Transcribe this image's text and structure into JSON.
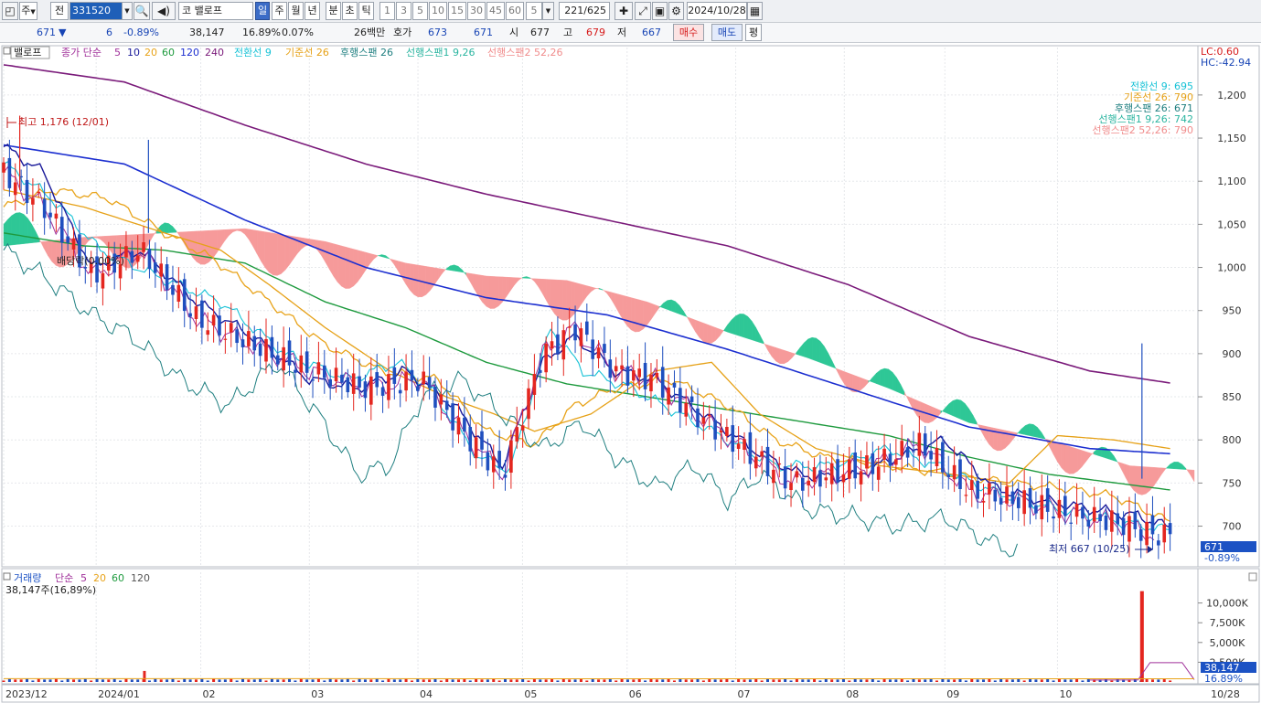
{
  "toolbar": {
    "market": "주",
    "prev": "전",
    "code": "331520",
    "name": "밸로프",
    "type_prefix": "코",
    "periods": [
      "일",
      "주",
      "월",
      "년",
      "분",
      "초",
      "틱"
    ],
    "active_period": "일",
    "minute_steps": [
      "1",
      "3",
      "5",
      "10",
      "15",
      "30",
      "45",
      "60"
    ],
    "step_value": "5",
    "count": "221",
    "count_total": "/625",
    "date": "2024/10/28"
  },
  "quote": {
    "price": "671",
    "change_arrow": "▼",
    "change": "6",
    "change_pct": "-0.89%",
    "volume": "38,147",
    "turnover_pct": "16.89%",
    "ratio": "0.07%",
    "amount": "26백만",
    "bid_label": "호가",
    "bid1": "673",
    "bid2": "671",
    "open_label": "시",
    "open": "677",
    "high_label": "고",
    "high": "679",
    "low_label": "저",
    "low": "667",
    "buy_label": "매수",
    "sell_label": "매도",
    "avg_label": "평"
  },
  "legend": {
    "top_box": "밸로프",
    "ma_title": "종가 단순",
    "ma_periods": [
      "5",
      "10",
      "20",
      "60",
      "120",
      "240"
    ],
    "ichimoku": [
      "전환선 9",
      "기준선 26",
      "후행스팬 26",
      "선행스팬1 9,26",
      "선행스팬2 52,26"
    ],
    "lc": "LC:0.60",
    "hc": "HC:-42.94"
  },
  "ichi_labels": [
    "전환선 9: 695",
    "기준선 26: 790",
    "후행스팬 26: 671",
    "선행스팬1 9,26: 742",
    "선행스팬2 52,26: 790"
  ],
  "annotations": {
    "high": "최고 1,176 (12/01)",
    "low": "최저 667 (10/25)",
    "ex_right": "배당락(0.00%)",
    "price_tag": "671",
    "price_tag_pct": "-0.89%"
  },
  "volume_legend": {
    "title": "거래량",
    "ma_title": "단순",
    "ma_periods": [
      "5",
      "20",
      "60",
      "120"
    ],
    "value": "38,147주(16,89%)",
    "tag": "38,147",
    "tag_pct": "16.89%"
  },
  "colors": {
    "up": "#e4261f",
    "down": "#1f4fbf",
    "ma5": "#a0309a",
    "ma10": "#1a1a9a",
    "ma20": "#e8a319",
    "ma60": "#1e9a3e",
    "ma120": "#1c2fd0",
    "ma240": "#7a1a7a",
    "tenkan": "#17c2d6",
    "kijun": "#e6a117",
    "chikou": "#1f7f80",
    "cloud_bull": "#2ec796",
    "cloud_bear": "#f69a9a",
    "span_a": "#2bb5a0",
    "span_b": "#f08c8c"
  },
  "chart_data": {
    "type": "candlestick",
    "y_axis": {
      "ticks": [
        "1,200",
        "1,150",
        "1,100",
        "1,050",
        "1,000",
        "950",
        "900",
        "850",
        "800",
        "750",
        "700"
      ],
      "tick_values": [
        1200,
        1150,
        1100,
        1050,
        1000,
        950,
        900,
        850,
        800,
        750,
        700
      ],
      "range": [
        655,
        1255
      ]
    },
    "volume_axis": {
      "ticks": [
        "10,000K",
        "7,500K",
        "5,000K",
        "2,500K"
      ],
      "tick_values": [
        10000,
        7500,
        5000,
        2500
      ],
      "range": [
        0,
        12500
      ]
    },
    "x_labels": [
      "2023/12",
      "2024/01",
      "02",
      "03",
      "04",
      "05",
      "06",
      "07",
      "08",
      "09",
      "10",
      "10/28"
    ],
    "x_label_days": [
      0,
      23,
      49,
      76,
      103,
      129,
      155,
      182,
      209,
      234,
      262,
      296
    ],
    "days_span": [
      0,
      296
    ],
    "series": [
      {
        "name": "전환선 9",
        "anchors": [
          [
            0,
            1120
          ],
          [
            12,
            1080
          ],
          [
            24,
            1020
          ],
          [
            38,
            990
          ],
          [
            54,
            960
          ],
          [
            70,
            900
          ],
          [
            86,
            870
          ],
          [
            98,
            890
          ],
          [
            106,
            860
          ],
          [
            118,
            780
          ],
          [
            126,
            765
          ],
          [
            136,
            930
          ],
          [
            144,
            880
          ],
          [
            156,
            860
          ],
          [
            168,
            830
          ],
          [
            180,
            800
          ],
          [
            192,
            770
          ],
          [
            206,
            770
          ],
          [
            220,
            790
          ],
          [
            232,
            770
          ],
          [
            246,
            740
          ],
          [
            262,
            720
          ],
          [
            278,
            705
          ],
          [
            286,
            698
          ],
          [
            290,
            695
          ]
        ]
      },
      {
        "name": "기준선 26",
        "anchors": [
          [
            0,
            1090
          ],
          [
            20,
            1070
          ],
          [
            40,
            1040
          ],
          [
            54,
            1020
          ],
          [
            66,
            980
          ],
          [
            80,
            930
          ],
          [
            96,
            880
          ],
          [
            110,
            850
          ],
          [
            122,
            830
          ],
          [
            132,
            810
          ],
          [
            146,
            830
          ],
          [
            162,
            880
          ],
          [
            176,
            890
          ],
          [
            188,
            830
          ],
          [
            202,
            790
          ],
          [
            218,
            770
          ],
          [
            236,
            760
          ],
          [
            250,
            750
          ],
          [
            262,
            805
          ],
          [
            276,
            800
          ],
          [
            290,
            790
          ]
        ]
      },
      {
        "name": "후행스팬 26",
        "anchors": [
          [
            0,
            1020
          ],
          [
            10,
            990
          ],
          [
            22,
            945
          ],
          [
            32,
            920
          ],
          [
            44,
            870
          ],
          [
            56,
            840
          ],
          [
            68,
            890
          ],
          [
            78,
            830
          ],
          [
            88,
            760
          ],
          [
            96,
            770
          ],
          [
            104,
            850
          ],
          [
            114,
            870
          ],
          [
            124,
            830
          ],
          [
            134,
            790
          ],
          [
            144,
            820
          ],
          [
            152,
            780
          ],
          [
            162,
            745
          ],
          [
            172,
            770
          ],
          [
            180,
            730
          ],
          [
            188,
            760
          ],
          [
            200,
            720
          ],
          [
            212,
            710
          ],
          [
            222,
            700
          ],
          [
            234,
            710
          ],
          [
            246,
            680
          ],
          [
            252,
            670
          ]
        ]
      },
      {
        "name": "이동평균 5",
        "anchors": [
          [
            0,
            1110
          ],
          [
            10,
            1070
          ],
          [
            22,
            990
          ],
          [
            34,
            1020
          ],
          [
            48,
            940
          ],
          [
            62,
            910
          ],
          [
            76,
            880
          ],
          [
            90,
            860
          ],
          [
            104,
            870
          ],
          [
            114,
            810
          ],
          [
            124,
            760
          ],
          [
            134,
            900
          ],
          [
            142,
            930
          ],
          [
            152,
            880
          ],
          [
            162,
            870
          ],
          [
            172,
            830
          ],
          [
            184,
            790
          ],
          [
            196,
            750
          ],
          [
            206,
            760
          ],
          [
            216,
            770
          ],
          [
            228,
            795
          ],
          [
            240,
            740
          ],
          [
            252,
            730
          ],
          [
            264,
            715
          ],
          [
            276,
            705
          ],
          [
            286,
            690
          ]
        ]
      },
      {
        "name": "이동평균 10",
        "anchors": [
          [
            0,
            1140
          ],
          [
            10,
            1110
          ],
          [
            22,
            1000
          ],
          [
            34,
            1020
          ],
          [
            48,
            960
          ],
          [
            62,
            920
          ],
          [
            76,
            870
          ],
          [
            88,
            860
          ],
          [
            100,
            880
          ],
          [
            112,
            840
          ],
          [
            124,
            770
          ],
          [
            134,
            890
          ],
          [
            142,
            920
          ],
          [
            152,
            880
          ],
          [
            162,
            870
          ],
          [
            174,
            830
          ],
          [
            186,
            790
          ],
          [
            198,
            760
          ],
          [
            210,
            755
          ],
          [
            222,
            780
          ],
          [
            234,
            800
          ],
          [
            246,
            745
          ],
          [
            258,
            730
          ],
          [
            270,
            720
          ],
          [
            282,
            712
          ],
          [
            290,
            698
          ]
        ]
      },
      {
        "name": "이동평균 20",
        "anchors": [
          [
            0,
            1070
          ],
          [
            12,
            1090
          ],
          [
            26,
            1080
          ],
          [
            40,
            1040
          ],
          [
            52,
            1010
          ],
          [
            66,
            960
          ],
          [
            80,
            910
          ],
          [
            94,
            880
          ],
          [
            108,
            870
          ],
          [
            120,
            810
          ],
          [
            132,
            795
          ],
          [
            142,
            840
          ],
          [
            152,
            860
          ],
          [
            166,
            870
          ],
          [
            180,
            840
          ],
          [
            192,
            800
          ],
          [
            204,
            780
          ],
          [
            220,
            770
          ],
          [
            236,
            760
          ],
          [
            250,
            750
          ],
          [
            262,
            745
          ],
          [
            276,
            735
          ],
          [
            290,
            705
          ]
        ]
      },
      {
        "name": "이동평균 60",
        "anchors": [
          [
            0,
            1040
          ],
          [
            20,
            1025
          ],
          [
            40,
            1020
          ],
          [
            60,
            1005
          ],
          [
            80,
            960
          ],
          [
            100,
            930
          ],
          [
            120,
            890
          ],
          [
            140,
            865
          ],
          [
            160,
            850
          ],
          [
            180,
            835
          ],
          [
            200,
            820
          ],
          [
            220,
            805
          ],
          [
            240,
            780
          ],
          [
            260,
            760
          ],
          [
            280,
            748
          ],
          [
            290,
            742
          ]
        ]
      },
      {
        "name": "이동평균 120",
        "anchors": [
          [
            0,
            1142
          ],
          [
            30,
            1120
          ],
          [
            60,
            1055
          ],
          [
            90,
            1000
          ],
          [
            120,
            965
          ],
          [
            150,
            945
          ],
          [
            180,
            905
          ],
          [
            210,
            860
          ],
          [
            240,
            815
          ],
          [
            270,
            790
          ],
          [
            290,
            784
          ]
        ]
      },
      {
        "name": "이동평균 240",
        "anchors": [
          [
            0,
            1235
          ],
          [
            30,
            1215
          ],
          [
            60,
            1165
          ],
          [
            90,
            1120
          ],
          [
            120,
            1085
          ],
          [
            150,
            1055
          ],
          [
            180,
            1025
          ],
          [
            210,
            980
          ],
          [
            240,
            920
          ],
          [
            270,
            880
          ],
          [
            290,
            866
          ]
        ]
      },
      {
        "name": "선행스팬1 9,26",
        "anchors": [
          [
            0,
            1050
          ],
          [
            20,
            1010
          ],
          [
            40,
            1030
          ],
          [
            60,
            1020
          ],
          [
            80,
            1000
          ],
          [
            100,
            990
          ],
          [
            120,
            975
          ],
          [
            140,
            960
          ],
          [
            160,
            945
          ],
          [
            180,
            930
          ],
          [
            200,
            900
          ],
          [
            220,
            860
          ],
          [
            240,
            820
          ],
          [
            260,
            790
          ],
          [
            280,
            760
          ],
          [
            296,
            750
          ]
        ]
      },
      {
        "name": "선행스팬2 52,26",
        "anchors": [
          [
            0,
            1025
          ],
          [
            20,
            1035
          ],
          [
            40,
            1040
          ],
          [
            60,
            1045
          ],
          [
            80,
            1030
          ],
          [
            100,
            1005
          ],
          [
            120,
            990
          ],
          [
            140,
            985
          ],
          [
            160,
            960
          ],
          [
            180,
            925
          ],
          [
            200,
            895
          ],
          [
            220,
            860
          ],
          [
            240,
            820
          ],
          [
            260,
            800
          ],
          [
            280,
            770
          ],
          [
            296,
            765
          ]
        ]
      }
    ],
    "volume": {
      "spike_day": 283,
      "spike_value": 11500,
      "baseline": 180
    }
  }
}
